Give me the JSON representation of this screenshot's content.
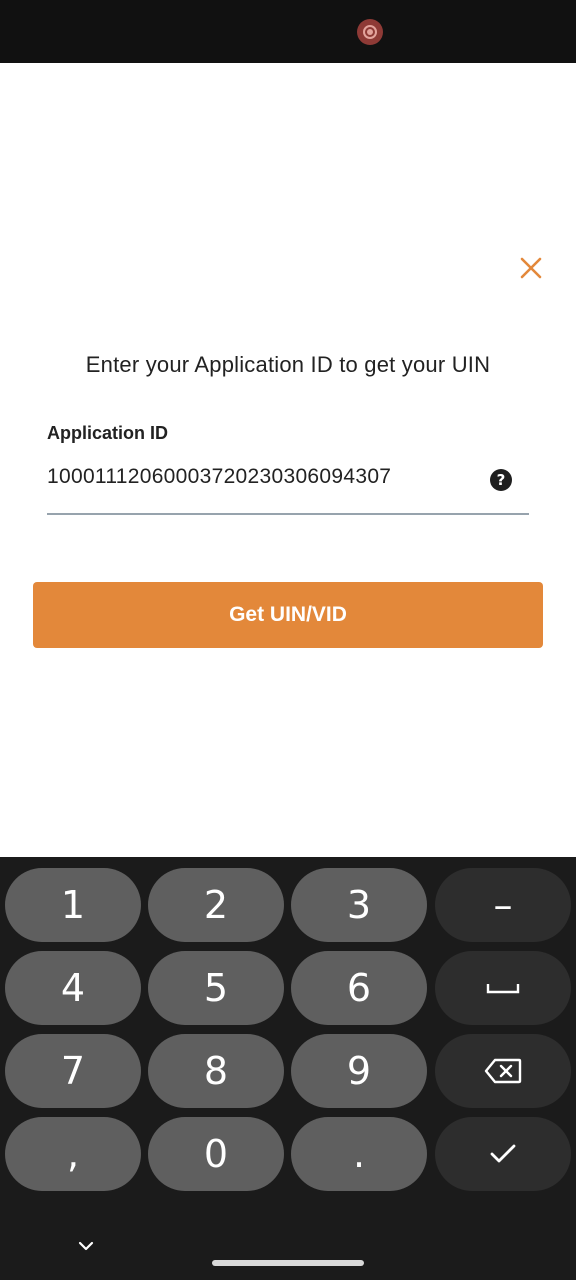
{
  "status_bar": {
    "record_icon": "screen-record-icon"
  },
  "dialog": {
    "close_icon": "close-icon",
    "prompt": "Enter your Application ID to get your UIN",
    "field_label": "Application ID",
    "field_value": "10001112060003720230306094307",
    "help_icon_glyph": "?",
    "button_label": "Get UIN/VID",
    "accent_color": "#e3883a"
  },
  "keyboard": {
    "keys": {
      "k1": "1",
      "k2": "2",
      "k3": "3",
      "minus": "–",
      "k4": "4",
      "k5": "5",
      "k6": "6",
      "k7": "7",
      "k8": "8",
      "k9": "9",
      "comma": ",",
      "k0": "0",
      "period": "."
    },
    "icons": {
      "space": "space-icon",
      "backspace": "backspace-icon",
      "done": "checkmark-icon",
      "hide": "chevron-down-icon"
    }
  }
}
